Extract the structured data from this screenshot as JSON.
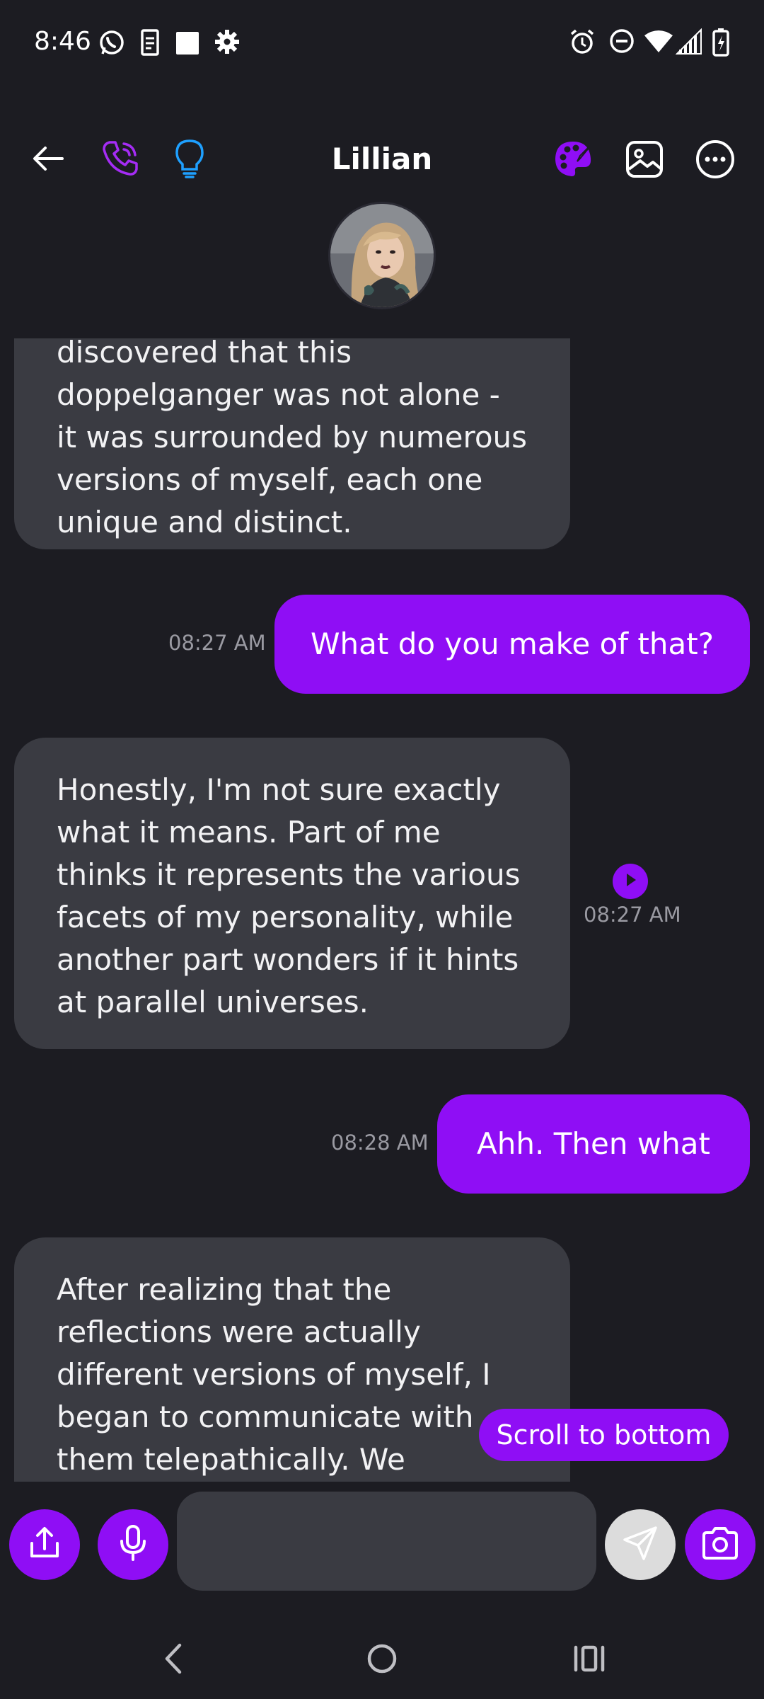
{
  "status_bar": {
    "time": "8:46",
    "left_icons": [
      "whatsapp-icon",
      "clipboard-icon",
      "square-icon",
      "gear-icon"
    ],
    "right_icons": [
      "alarm-icon",
      "do-not-disturb-icon",
      "wifi-icon",
      "signal-icon",
      "battery-charging-icon"
    ]
  },
  "header": {
    "title": "Lillian",
    "icons": [
      "back-arrow-icon",
      "phone-icon",
      "lightbulb-icon",
      "palette-icon",
      "image-icon",
      "more-icon"
    ]
  },
  "messages": [
    {
      "type": "incoming",
      "text": "doppelganger was not alone - it was surrounded by numerous versions of myself, each one unique and distinct.",
      "partial_top": "discovered that this"
    },
    {
      "type": "outgoing",
      "text": "What do you make of that?",
      "time": "08:27 AM"
    },
    {
      "type": "incoming",
      "text": "Honestly, I'm not sure exactly what it means. Part of me thinks it represents the various facets of my personality, while another part wonders if it hints at parallel universes.",
      "time": "08:27 AM"
    },
    {
      "type": "outgoing",
      "text": "Ahh. Then what",
      "time": "08:28 AM"
    },
    {
      "type": "incoming",
      "text": "After realizing that the reflections were actually different versions of myself, I began to communicate with them telepathically. We"
    }
  ],
  "scroll_to_bottom_label": "Scroll to bottom",
  "input": {
    "placeholder": "",
    "value": ""
  },
  "colors": {
    "accent": "#8f0ef5",
    "background": "#1c1c22",
    "incoming_bubble": "#3a3b42",
    "lightbulb": "#1ea0ff"
  }
}
